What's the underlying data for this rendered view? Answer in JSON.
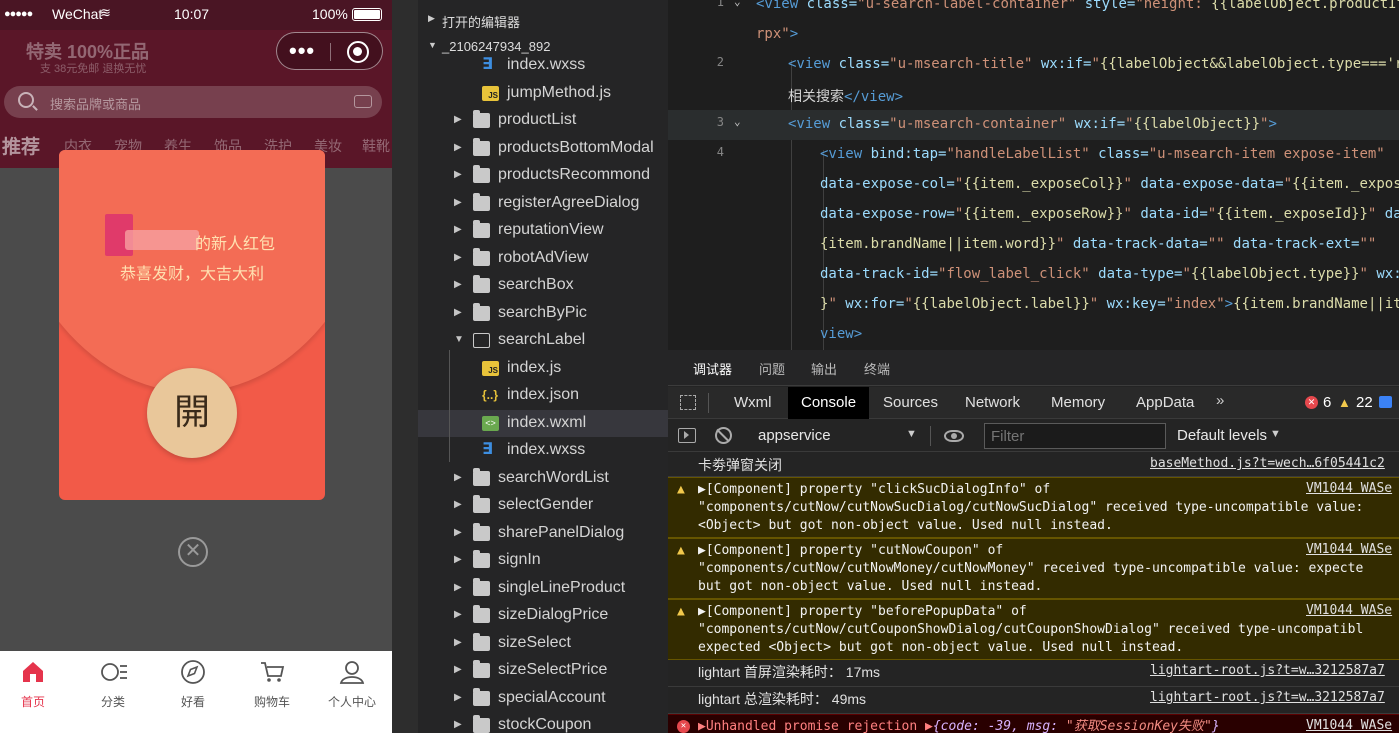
{
  "phone": {
    "status": {
      "signal": "●●●●●",
      "carrier": "WeChat",
      "wifi": "≋",
      "time": "10:07",
      "battery": "100%"
    },
    "header": {
      "promo_title": "特卖 100%正品",
      "promo_sub": "支    38元免邮    退换无忧",
      "capsule_dots": "•••"
    },
    "search_placeholder": "搜索品牌或商品",
    "categories": [
      "推荐",
      "内衣",
      "宠物",
      "养生",
      "饰品",
      "洗护",
      "美妆",
      "鞋靴"
    ],
    "red_packet": {
      "title_tail": "的新人红包",
      "greeting": "恭喜发财，大吉大利",
      "open_label": "開",
      "close_glyph": "✕"
    },
    "tabbar": [
      {
        "label": "首页",
        "icon": "home-icon",
        "active": true
      },
      {
        "label": "分类",
        "icon": "category-icon",
        "active": false
      },
      {
        "label": "好看",
        "icon": "compass-icon",
        "active": false
      },
      {
        "label": "购物车",
        "icon": "cart-icon",
        "active": false
      },
      {
        "label": "个人中心",
        "icon": "user-icon",
        "active": false
      }
    ]
  },
  "explorer": {
    "section_open_editors": "打开的编辑器",
    "section_project": "_2106247934_892",
    "items": [
      {
        "name": "index.wxss",
        "type": "css",
        "depth": 2
      },
      {
        "name": "jumpMethod.js",
        "type": "js",
        "depth": 2
      },
      {
        "name": "productList",
        "type": "folder",
        "depth": 1
      },
      {
        "name": "productsBottomModal",
        "type": "folder",
        "depth": 1
      },
      {
        "name": "productsRecommond",
        "type": "folder",
        "depth": 1
      },
      {
        "name": "registerAgreeDialog",
        "type": "folder",
        "depth": 1
      },
      {
        "name": "reputationView",
        "type": "folder",
        "depth": 1
      },
      {
        "name": "robotAdView",
        "type": "folder",
        "depth": 1
      },
      {
        "name": "searchBox",
        "type": "folder",
        "depth": 1
      },
      {
        "name": "searchByPic",
        "type": "folder",
        "depth": 1
      },
      {
        "name": "searchLabel",
        "type": "folder-open",
        "depth": 1
      },
      {
        "name": "index.js",
        "type": "js",
        "depth": 2
      },
      {
        "name": "index.json",
        "type": "json",
        "depth": 2
      },
      {
        "name": "index.wxml",
        "type": "wxml",
        "depth": 2,
        "selected": true
      },
      {
        "name": "index.wxss",
        "type": "css",
        "depth": 2
      },
      {
        "name": "searchWordList",
        "type": "folder",
        "depth": 1
      },
      {
        "name": "selectGender",
        "type": "folder",
        "depth": 1
      },
      {
        "name": "sharePanelDialog",
        "type": "folder",
        "depth": 1
      },
      {
        "name": "signIn",
        "type": "folder",
        "depth": 1
      },
      {
        "name": "singleLineProduct",
        "type": "folder",
        "depth": 1
      },
      {
        "name": "sizeDialogPrice",
        "type": "folder",
        "depth": 1
      },
      {
        "name": "sizeSelect",
        "type": "folder",
        "depth": 1
      },
      {
        "name": "sizeSelectPrice",
        "type": "folder",
        "depth": 1
      },
      {
        "name": "specialAccount",
        "type": "folder",
        "depth": 1
      },
      {
        "name": "stockCoupon",
        "type": "folder",
        "depth": 1
      }
    ]
  },
  "editor": {
    "lines": [
      {
        "num": "1",
        "fold": "⌄",
        "indent": 0,
        "tokens": [
          [
            "tag",
            "<view "
          ],
          [
            "attr",
            "class="
          ],
          [
            "str",
            "\"u-search-label-container\" "
          ],
          [
            "attr",
            "style="
          ],
          [
            "str",
            "\"height: "
          ],
          [
            "exp",
            "{{labelObject.productItem"
          ]
        ]
      },
      {
        "num": "",
        "fold": "",
        "indent": 0,
        "tokens": [
          [
            "str",
            "rpx\""
          ],
          [
            "tag",
            ">"
          ]
        ]
      },
      {
        "num": "2",
        "fold": "",
        "indent": 1,
        "tokens": [
          [
            "tag",
            "<view "
          ],
          [
            "attr",
            "class="
          ],
          [
            "str",
            "\"u-msearch-title\" "
          ],
          [
            "attr",
            "wx:if="
          ],
          [
            "str",
            "\""
          ],
          [
            "exp",
            "{{labelObject&&labelObject.type==='re"
          ]
        ]
      },
      {
        "num": "",
        "fold": "",
        "indent": 1,
        "tokens": [
          [
            "txt",
            "相关搜索"
          ],
          [
            "tag",
            "</view>"
          ]
        ]
      },
      {
        "num": "3",
        "fold": "⌄",
        "indent": 1,
        "current": true,
        "tokens": [
          [
            "tag",
            "<view "
          ],
          [
            "attr",
            "class="
          ],
          [
            "str",
            "\"u-msearch-container\" "
          ],
          [
            "attr",
            "wx:if="
          ],
          [
            "str",
            "\""
          ],
          [
            "exp",
            "{{labelObject}}"
          ],
          [
            "str",
            "\""
          ],
          [
            "tag",
            ">"
          ]
        ]
      },
      {
        "num": "4",
        "fold": "",
        "indent": 2,
        "tokens": [
          [
            "tag",
            "<view "
          ],
          [
            "attr",
            "bind:tap="
          ],
          [
            "str",
            "\"handleLabelList\" "
          ],
          [
            "attr",
            "class="
          ],
          [
            "str",
            "\"u-msearch-item expose-item\""
          ]
        ]
      },
      {
        "num": "",
        "fold": "",
        "indent": 2,
        "tokens": [
          [
            "attr",
            "data-expose-col="
          ],
          [
            "str",
            "\""
          ],
          [
            "exp",
            "{{item._exposeCol}}"
          ],
          [
            "str",
            "\" "
          ],
          [
            "attr",
            "data-expose-data="
          ],
          [
            "str",
            "\""
          ],
          [
            "exp",
            "{{item._expose"
          ]
        ]
      },
      {
        "num": "",
        "fold": "",
        "indent": 2,
        "tokens": [
          [
            "attr",
            "data-expose-row="
          ],
          [
            "str",
            "\""
          ],
          [
            "exp",
            "{{item._exposeRow}}"
          ],
          [
            "str",
            "\" "
          ],
          [
            "attr",
            "data-id="
          ],
          [
            "str",
            "\""
          ],
          [
            "exp",
            "{{item._exposeId}}"
          ],
          [
            "str",
            "\" "
          ],
          [
            "attr",
            "dat"
          ]
        ]
      },
      {
        "num": "",
        "fold": "",
        "indent": 2,
        "tokens": [
          [
            "exp",
            "{item.brandName||item.word}}"
          ],
          [
            "str",
            "\" "
          ],
          [
            "attr",
            "data-track-data="
          ],
          [
            "str",
            "\"\" "
          ],
          [
            "attr",
            "data-track-ext="
          ],
          [
            "str",
            "\"\""
          ]
        ]
      },
      {
        "num": "",
        "fold": "",
        "indent": 2,
        "tokens": [
          [
            "attr",
            "data-track-id="
          ],
          [
            "str",
            "\"flow_label_click\" "
          ],
          [
            "attr",
            "data-type="
          ],
          [
            "str",
            "\""
          ],
          [
            "exp",
            "{{labelObject.type}}"
          ],
          [
            "str",
            "\" "
          ],
          [
            "attr",
            "wx:i"
          ]
        ]
      },
      {
        "num": "",
        "fold": "",
        "indent": 2,
        "tokens": [
          [
            "exp",
            "}"
          ],
          [
            "str",
            "\" "
          ],
          [
            "attr",
            "wx:for="
          ],
          [
            "str",
            "\""
          ],
          [
            "exp",
            "{{labelObject.label}}"
          ],
          [
            "str",
            "\" "
          ],
          [
            "attr",
            "wx:key="
          ],
          [
            "str",
            "\"index\""
          ],
          [
            "tag",
            ">"
          ],
          [
            "exp",
            "{{item.brandName||ite"
          ]
        ]
      },
      {
        "num": "",
        "fold": "",
        "indent": 2,
        "tokens": [
          [
            "tag",
            "view>"
          ]
        ]
      }
    ]
  },
  "devtools": {
    "panels": [
      "调试器",
      "问题",
      "输出",
      "终端"
    ],
    "tabs": [
      "Wxml",
      "Console",
      "Sources",
      "Network",
      "Memory",
      "AppData"
    ],
    "active_tab": "Console",
    "more": "»",
    "error_count": "6",
    "warning_count": "22",
    "context": "appservice",
    "filter_placeholder": "Filter",
    "levels": "Default levels",
    "messages": [
      {
        "type": "log",
        "text": "卡劵弹窗关闭",
        "src": "baseMethod.js?t=wech…6f05441c2"
      },
      {
        "type": "warn",
        "text": "▶[Component] property \"clickSucDialogInfo\" of\n\"components/cutNow/cutNowSucDialog/cutNowSucDialog\" received type-uncompatible value:\n<Object> but got non-object value. Used null instead.",
        "src": "VM1044 WASe"
      },
      {
        "type": "warn",
        "text": "▶[Component] property \"cutNowCoupon\" of\n\"components/cutNow/cutNowMoney/cutNowMoney\" received type-uncompatible value: expecte\nbut got non-object value. Used null instead.",
        "src": "VM1044 WASe"
      },
      {
        "type": "warn",
        "text": "▶[Component] property \"beforePopupData\" of\n\"components/cutNow/cutCouponShowDialog/cutCouponShowDialog\" received type-uncompatibl\nexpected <Object> but got non-object value. Used null instead.",
        "src": "VM1044 WASe"
      },
      {
        "type": "log",
        "text": "lightart 首屏渲染耗时： 17ms",
        "src": "lightart-root.js?t=w…3212587a7"
      },
      {
        "type": "log",
        "text": "lightart 总渲染耗时： 49ms",
        "src": "lightart-root.js?t=w…3212587a7"
      },
      {
        "type": "error",
        "text": "▶Unhandled promise rejection ▶",
        "obj_a": "{code: ",
        "obj_num": "-39",
        "obj_b": ", msg: ",
        "obj_str": "\"获取SessionKey失败\"",
        "obj_c": "}",
        "src": "VM1044 WASe"
      }
    ]
  }
}
